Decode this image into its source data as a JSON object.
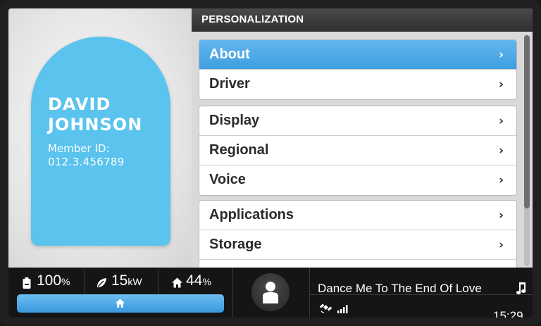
{
  "profile": {
    "first_name": "DAVID",
    "last_name": "JOHNSON",
    "member_label": "Member ID:",
    "member_id": "012.3.456789",
    "card_color": "#5ac3ee"
  },
  "panel": {
    "title": "PERSONALIZATION",
    "groups": [
      {
        "items": [
          {
            "label": "About",
            "active": true
          },
          {
            "label": "Driver"
          }
        ]
      },
      {
        "items": [
          {
            "label": "Display"
          },
          {
            "label": "Regional"
          },
          {
            "label": "Voice"
          }
        ]
      },
      {
        "items": [
          {
            "label": "Applications"
          },
          {
            "label": "Storage"
          }
        ]
      }
    ],
    "chevron": "›",
    "accent": "#3e9fe0"
  },
  "status_bar": {
    "battery": {
      "value": "100",
      "unit": "%",
      "icon": "battery-icon"
    },
    "energy": {
      "value": "15",
      "unit": "kW",
      "icon": "leaf-icon"
    },
    "home": {
      "value": "44",
      "unit": "%",
      "icon": "home-icon"
    },
    "home_button_icon": "home-icon",
    "avatar_icon": "person-icon"
  },
  "media": {
    "song": "Dance Me To The End Of Love",
    "music_icon": "music-note-icon",
    "gps_icon": "satellite-icon",
    "signal_icon": "signal-bars-icon",
    "time": "15:29"
  }
}
